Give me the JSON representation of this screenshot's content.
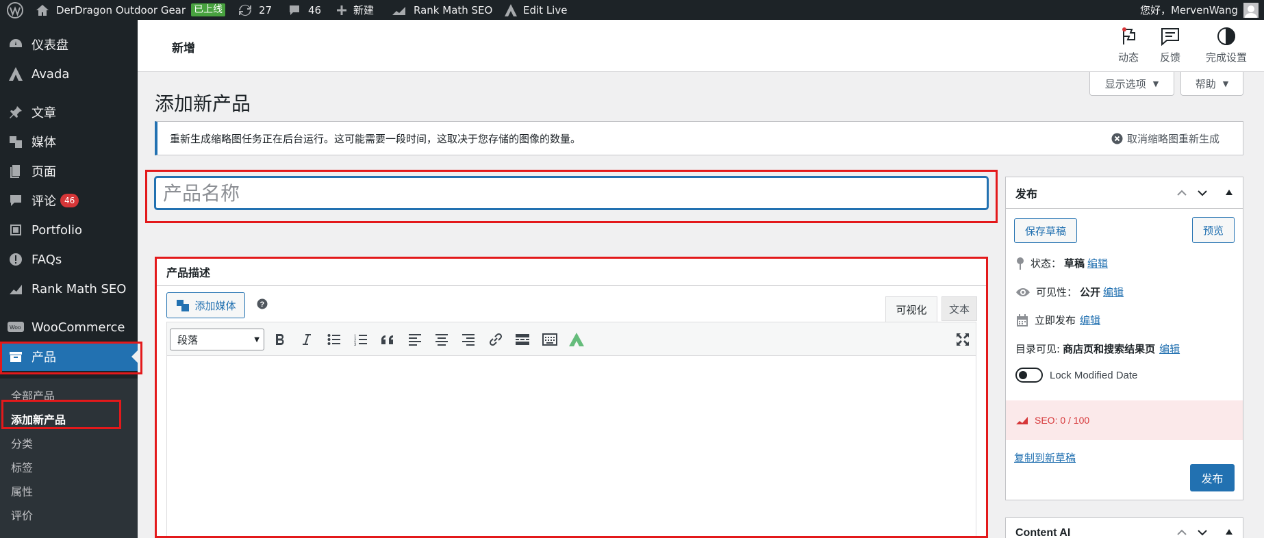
{
  "adminbar": {
    "site_name": "DerDragon Outdoor Gear",
    "live_badge": "已上线",
    "updates": "27",
    "comments": "46",
    "new": "新建",
    "rank_math": "Rank Math SEO",
    "edit_live": "Edit Live",
    "greeting": "您好，MervenWang"
  },
  "sidebar": {
    "items": [
      {
        "label": "仪表盘",
        "icon": "dashboard-icon"
      },
      {
        "label": "Avada",
        "icon": "avada-icon"
      },
      {
        "label": "文章",
        "icon": "pin-icon"
      },
      {
        "label": "媒体",
        "icon": "media-icon"
      },
      {
        "label": "页面",
        "icon": "pages-icon"
      },
      {
        "label": "评论",
        "icon": "comment-icon",
        "badge": "46"
      },
      {
        "label": "Portfolio",
        "icon": "portfolio-icon"
      },
      {
        "label": "FAQs",
        "icon": "faq-icon"
      },
      {
        "label": "Rank Math SEO",
        "icon": "rankmath-icon"
      },
      {
        "label": "WooCommerce",
        "icon": "woo-icon"
      },
      {
        "label": "产品",
        "icon": "product-icon"
      }
    ],
    "submenu": [
      "全部产品",
      "添加新产品",
      "分类",
      "标签",
      "属性",
      "评价"
    ]
  },
  "header": {
    "title": "新增",
    "activity": "动态",
    "feedback": "反馈",
    "finish_setup": "完成设置",
    "screen_options": "显示选项",
    "help": "帮助"
  },
  "page_title": "添加新产品",
  "notice": {
    "text": "重新生成缩略图任务正在后台运行。这可能需要一段时间，这取决于您存储的图像的数量。",
    "cancel": "取消缩略图重新生成"
  },
  "title_input": {
    "placeholder": "产品名称",
    "value": ""
  },
  "editor": {
    "heading": "产品描述",
    "add_media": "添加媒体",
    "tab_visual": "可视化",
    "tab_text": "文本",
    "format_select": "段落"
  },
  "publish": {
    "heading": "发布",
    "save_draft": "保存草稿",
    "preview": "预览",
    "status_label": "状态：",
    "status_value": "草稿",
    "visibility_label": "可见性：",
    "visibility_value": "公开",
    "publish_time": "立即发布",
    "catalog_label": "目录可见:",
    "catalog_value": "商店页和搜索结果页",
    "edit": "编辑",
    "lock_modified": "Lock Modified Date",
    "seo_score": "SEO: 0 / 100",
    "copy_draft": "复制到新草稿",
    "publish_button": "发布"
  },
  "content_ai": {
    "heading": "Content AI"
  },
  "colors": {
    "accent": "#2271b1",
    "admin_dark": "#1d2327",
    "highlight": "#e3191b",
    "live_green": "#48a23f"
  }
}
